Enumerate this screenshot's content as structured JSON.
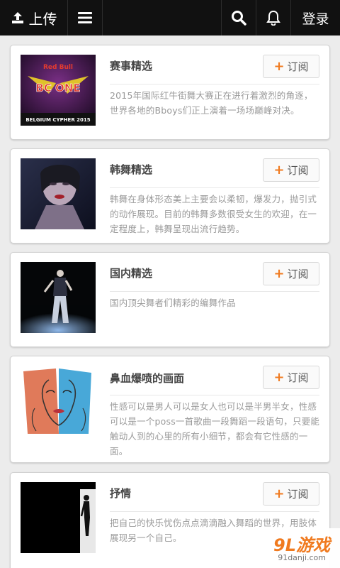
{
  "topbar": {
    "upload_label": "上传",
    "login_label": "登录",
    "upload_icon": "upload-icon",
    "menu_icon": "menu-icon",
    "search_icon": "search-icon",
    "bell_icon": "bell-icon"
  },
  "subscribe_label": "订阅",
  "accent_color": "#f07a1f",
  "cards": [
    {
      "title": "赛事精选",
      "desc": "2015年国际红牛街舞大赛正在进行着激烈的角逐，世界各地的Bboys们正上演着一场场巅峰对决。",
      "thumb_text_1": "Red Bull",
      "thumb_text_2": "BC ONE",
      "thumb_text_3": "BELGIUM CYPHER 2015"
    },
    {
      "title": "韩舞精选",
      "desc": "韩舞在身体形态美上主要会以柔韧，爆发力，抛引式的动作展现。目前的韩舞多数很受女生的欢迎，在一定程度上，韩舞呈现出流行趋势。"
    },
    {
      "title": "国内精选",
      "desc": "国内顶尖舞者们精彩的编舞作品"
    },
    {
      "title": "鼻血爆喷的画面",
      "desc": "性感可以是男人可以是女人也可以是半男半女，性感可以是一个poss一首歌曲一段舞蹈一段语句，只要能触动人到的心里的所有小细节，都会有它性感的一面。"
    },
    {
      "title": "抒情",
      "desc": "把自己的快乐忧伤点点滴滴融入舞蹈的世界，用肢体展现另一个自己。"
    }
  ],
  "watermark": {
    "logo": "9L游戏",
    "url": "91danji.com"
  }
}
